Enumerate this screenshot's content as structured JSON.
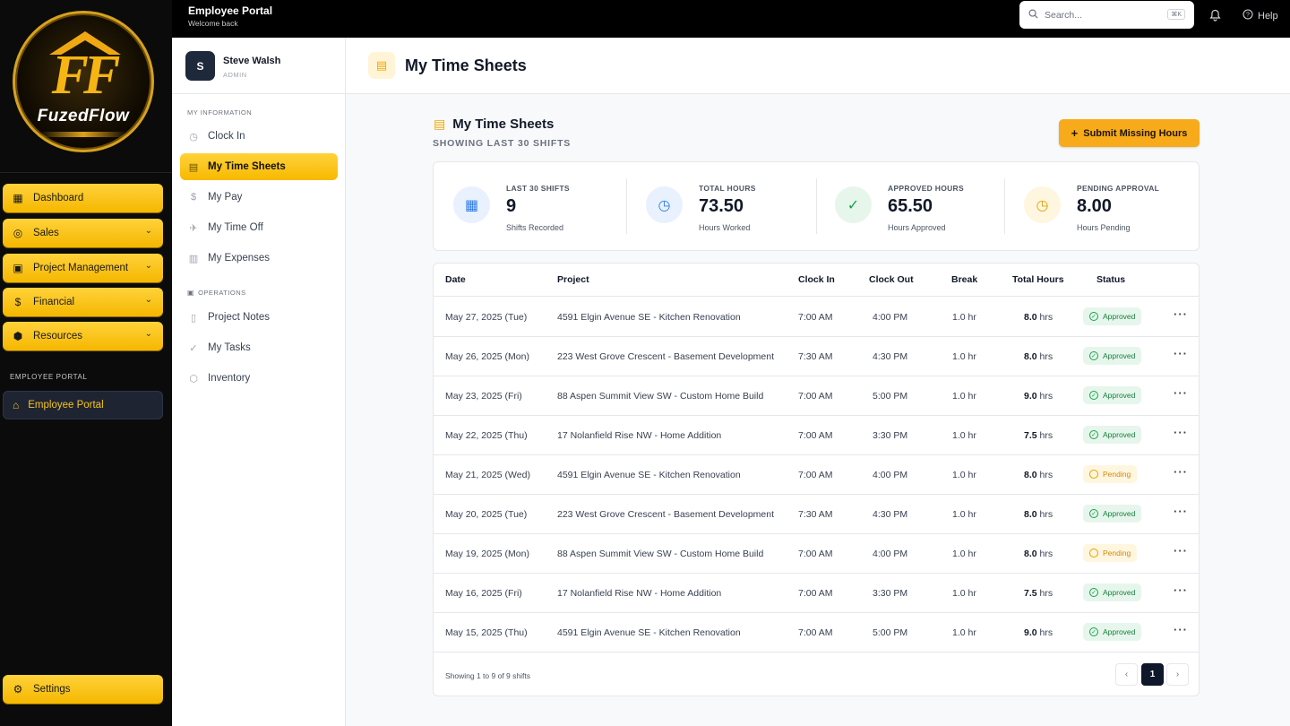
{
  "brand": {
    "logo_text": "FuzedFlow",
    "logo_mark": "FF",
    "accent": "#f7b900"
  },
  "main_nav": {
    "items": [
      {
        "label": "Dashboard",
        "icon": "grid-icon",
        "glyph": "▦",
        "expandable": false
      },
      {
        "label": "Sales",
        "icon": "target-icon",
        "glyph": "◎",
        "expandable": true
      },
      {
        "label": "Project Management",
        "icon": "briefcase-icon",
        "glyph": "▣",
        "expandable": true
      },
      {
        "label": "Financial",
        "icon": "dollar-icon",
        "glyph": "$",
        "expandable": true
      },
      {
        "label": "Resources",
        "icon": "box-icon",
        "glyph": "⬢",
        "expandable": true
      }
    ],
    "section_label": "EMPLOYEE PORTAL",
    "portal_label": "Employee Portal",
    "settings_label": "Settings"
  },
  "header": {
    "title": "Employee Portal",
    "subtitle": "Welcome back",
    "search_placeholder": "Search...",
    "search_shortcut": "⌘K",
    "help_label": "Help"
  },
  "user": {
    "initial": "S",
    "name": "Steve Walsh",
    "role": "ADMIN"
  },
  "subnav": {
    "section1": "MY INFORMATION",
    "section1_items": [
      {
        "label": "Clock In",
        "icon": "clock-icon",
        "glyph": "◷",
        "active": false
      },
      {
        "label": "My Time Sheets",
        "icon": "document-icon",
        "glyph": "▤",
        "active": true
      },
      {
        "label": "My Pay",
        "icon": "dollar-icon",
        "glyph": "$",
        "active": false
      },
      {
        "label": "My Time Off",
        "icon": "plane-icon",
        "glyph": "✈",
        "active": false
      },
      {
        "label": "My Expenses",
        "icon": "receipt-icon",
        "glyph": "▥",
        "active": false
      }
    ],
    "section2": "OPERATIONS",
    "section2_items": [
      {
        "label": "Project Notes",
        "icon": "book-icon",
        "glyph": "▯",
        "active": false
      },
      {
        "label": "My Tasks",
        "icon": "check-circle-icon",
        "glyph": "✓",
        "active": false
      },
      {
        "label": "Inventory",
        "icon": "package-icon",
        "glyph": "⬡",
        "active": false
      }
    ]
  },
  "page": {
    "title": "My Time Sheets",
    "content_title": "My Time Sheets",
    "content_subtitle": "SHOWING LAST 30 SHIFTS",
    "submit_label": "Submit Missing Hours"
  },
  "stats": [
    {
      "label": "LAST 30 SHIFTS",
      "value": "9",
      "note": "Shifts Recorded",
      "icon": "calendar-icon",
      "glyph": "▦",
      "bg": "#e8f1fd",
      "fg": "#2f7be8"
    },
    {
      "label": "TOTAL HOURS",
      "value": "73.50",
      "note": "Hours Worked",
      "icon": "clock-icon",
      "glyph": "◷",
      "bg": "#e8f1fd",
      "fg": "#2f7be8"
    },
    {
      "label": "APPROVED HOURS",
      "value": "65.50",
      "note": "Hours Approved",
      "icon": "check-circle-icon",
      "glyph": "✓",
      "bg": "#e6f6ea",
      "fg": "#16a34a"
    },
    {
      "label": "PENDING APPROVAL",
      "value": "8.00",
      "note": "Hours Pending",
      "icon": "clock-icon",
      "glyph": "◷",
      "bg": "#fff6df",
      "fg": "#e0a100"
    }
  ],
  "table": {
    "columns": [
      "Date",
      "Project",
      "Clock In",
      "Clock Out",
      "Break",
      "Total Hours",
      "Status"
    ],
    "rows": [
      {
        "date": "May 27, 2025 (Tue)",
        "project": "4591 Elgin Avenue SE - Kitchen Renovation",
        "clock_in": "7:00 AM",
        "clock_out": "4:00 PM",
        "break": "1.0 hr",
        "hours": "8.0",
        "unit": "hrs",
        "status": "Approved"
      },
      {
        "date": "May 26, 2025 (Mon)",
        "project": "223 West Grove Crescent - Basement Development",
        "clock_in": "7:30 AM",
        "clock_out": "4:30 PM",
        "break": "1.0 hr",
        "hours": "8.0",
        "unit": "hrs",
        "status": "Approved"
      },
      {
        "date": "May 23, 2025 (Fri)",
        "project": "88 Aspen Summit View SW - Custom Home Build",
        "clock_in": "7:00 AM",
        "clock_out": "5:00 PM",
        "break": "1.0 hr",
        "hours": "9.0",
        "unit": "hrs",
        "status": "Approved"
      },
      {
        "date": "May 22, 2025 (Thu)",
        "project": "17 Nolanfield Rise NW - Home Addition",
        "clock_in": "7:00 AM",
        "clock_out": "3:30 PM",
        "break": "1.0 hr",
        "hours": "7.5",
        "unit": "hrs",
        "status": "Approved"
      },
      {
        "date": "May 21, 2025 (Wed)",
        "project": "4591 Elgin Avenue SE - Kitchen Renovation",
        "clock_in": "7:00 AM",
        "clock_out": "4:00 PM",
        "break": "1.0 hr",
        "hours": "8.0",
        "unit": "hrs",
        "status": "Pending"
      },
      {
        "date": "May 20, 2025 (Tue)",
        "project": "223 West Grove Crescent - Basement Development",
        "clock_in": "7:30 AM",
        "clock_out": "4:30 PM",
        "break": "1.0 hr",
        "hours": "8.0",
        "unit": "hrs",
        "status": "Approved"
      },
      {
        "date": "May 19, 2025 (Mon)",
        "project": "88 Aspen Summit View SW - Custom Home Build",
        "clock_in": "7:00 AM",
        "clock_out": "4:00 PM",
        "break": "1.0 hr",
        "hours": "8.0",
        "unit": "hrs",
        "status": "Pending"
      },
      {
        "date": "May 16, 2025 (Fri)",
        "project": "17 Nolanfield Rise NW - Home Addition",
        "clock_in": "7:00 AM",
        "clock_out": "3:30 PM",
        "break": "1.0 hr",
        "hours": "7.5",
        "unit": "hrs",
        "status": "Approved"
      },
      {
        "date": "May 15, 2025 (Thu)",
        "project": "4591 Elgin Avenue SE - Kitchen Renovation",
        "clock_in": "7:00 AM",
        "clock_out": "5:00 PM",
        "break": "1.0 hr",
        "hours": "9.0",
        "unit": "hrs",
        "status": "Approved"
      }
    ],
    "footer": "Showing 1 to 9 of 9 shifts",
    "pagination": {
      "prev": "‹",
      "current": "1",
      "next": "›"
    }
  }
}
